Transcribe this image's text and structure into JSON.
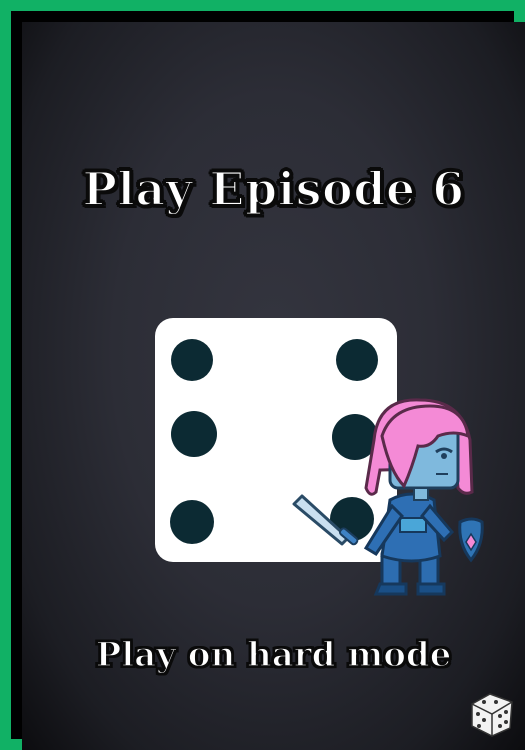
{
  "card": {
    "title": "Play Episode 6",
    "subtitle": "Play on hard mode",
    "die_face_value": 6,
    "icons": {
      "main_die": "die-six-icon",
      "character": "knight-character-icon",
      "corner": "dice-icon"
    },
    "colors": {
      "frame": "#11b165",
      "background": "#2c2d36",
      "die_face": "#ffffff",
      "die_pip": "#0c2a33",
      "hair": "#f48ad6",
      "armor": "#1f5e9c"
    }
  }
}
